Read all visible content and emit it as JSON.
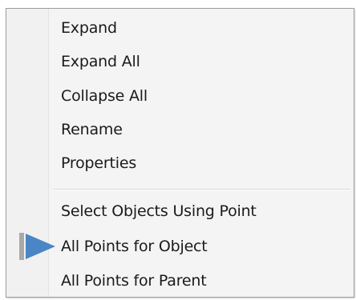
{
  "context_menu": {
    "group1": [
      {
        "label": "Expand"
      },
      {
        "label": "Expand All"
      },
      {
        "label": "Collapse All"
      },
      {
        "label": "Rename"
      },
      {
        "label": "Properties"
      }
    ],
    "group2": [
      {
        "label": "Select Objects Using Point"
      },
      {
        "label": "All Points for Object"
      },
      {
        "label": "All Points for Parent"
      }
    ],
    "current_item_marker": {
      "icon": "arrow-pointer-icon",
      "color": "#4a86c5",
      "points_to": "All Points for Object"
    }
  }
}
